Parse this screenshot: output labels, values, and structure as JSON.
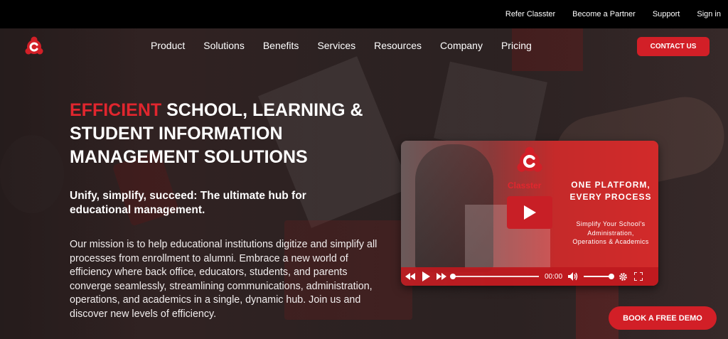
{
  "topbar": {
    "links": [
      "Refer Classter",
      "Become a Partner",
      "Support",
      "Sign in"
    ]
  },
  "nav": {
    "items": [
      "Product",
      "Solutions",
      "Benefits",
      "Services",
      "Resources",
      "Company",
      "Pricing"
    ],
    "contact_label": "CONTACT US"
  },
  "hero": {
    "headline_accent": "EFFICIENT",
    "headline_rest": "SCHOOL, LEARNING & STUDENT INFORMATION MANAGEMENT SOLUTIONS",
    "subheadline": "Unify, simplify, succeed: The ultimate hub for educational management.",
    "body": "Our mission is to help educational institutions digitize and simplify all processes from enrollment to alumni. Embrace a new world of efficiency where back office, educators, students, and parents converge seamlessly, streamlining communications, administration, operations, and academics in a single, dynamic hub. Join us and discover new levels of efficiency."
  },
  "video": {
    "brand": "Classter",
    "title": "ONE PLATFORM, EVERY PROCESS",
    "description": "Simplify Your School's Administration, Operations & Academics",
    "time": "00:00",
    "progress": 0,
    "volume": 1
  },
  "demo": {
    "label": "BOOK A FREE DEMO"
  },
  "colors": {
    "accent": "#d21f27",
    "topbar": "#000000"
  }
}
